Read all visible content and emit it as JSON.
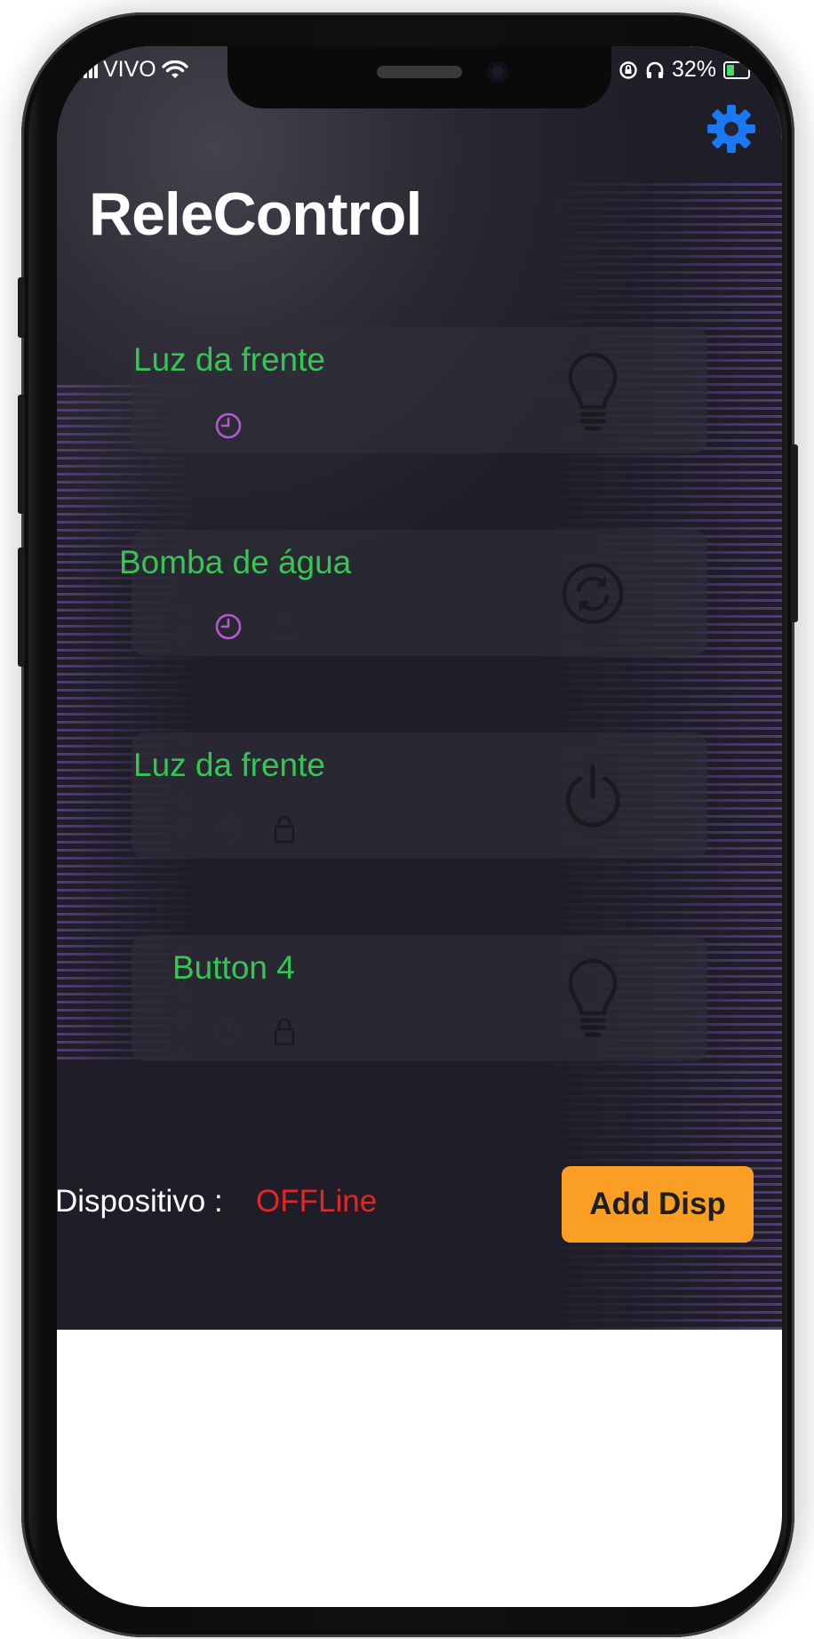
{
  "status_bar": {
    "carrier": "VIVO",
    "battery": "32%"
  },
  "app": {
    "title": "ReleControl"
  },
  "cards": [
    {
      "label": "Luz da frente",
      "icon": "lightbulb-icon",
      "timer_active": true,
      "lock_active": false
    },
    {
      "label": "Bomba de água",
      "icon": "sync-icon",
      "timer_active": true,
      "lock_active": false
    },
    {
      "label": "Luz da frente",
      "icon": "power-icon",
      "timer_active": false,
      "lock_active": true
    },
    {
      "label": "Button 4",
      "icon": "lightbulb-icon",
      "timer_active": false,
      "lock_active": true
    }
  ],
  "footer": {
    "device_label": "Dispositivo :",
    "device_status": "OFFLine",
    "add_button": "Add Disp"
  },
  "colors": {
    "accent": "#1a78f2",
    "label_green": "#35c653",
    "offline_red": "#e02727",
    "button_orange": "#fb9e24",
    "timer_active": "#b45ccf"
  }
}
